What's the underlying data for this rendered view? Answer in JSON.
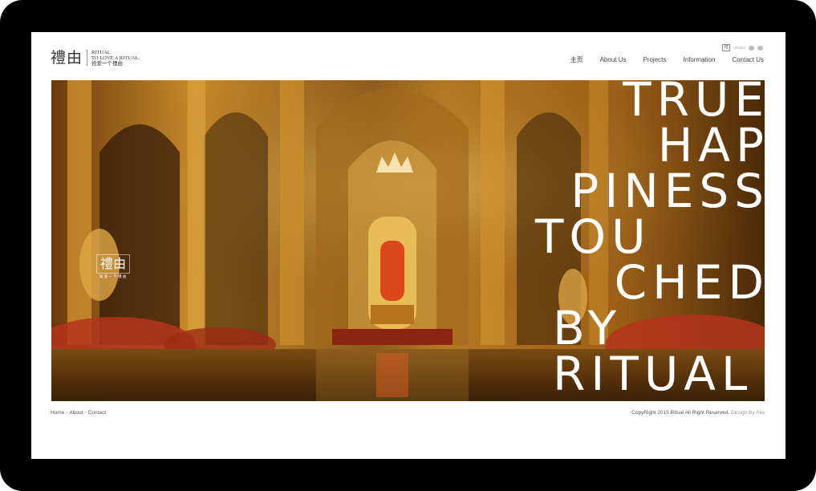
{
  "logo": {
    "mark": "禮由",
    "line1": "RITUAL",
    "line2": "TO LOVE A RITUAL.",
    "line3": "拾爱一个禮由"
  },
  "social": {
    "box": "禮",
    "text": "WEIBO"
  },
  "nav": {
    "items": [
      "主页",
      "About Us",
      "Projects",
      "Information",
      "Contact Us"
    ]
  },
  "hero": {
    "slogan": [
      "TRUE",
      "HAP",
      "PINESS",
      "TOU",
      "CHED",
      "BY",
      "RITUAL"
    ],
    "inner_logo": "禮由",
    "inner_logo_sub": "拾 爱 一 个 禮 由"
  },
  "footer": {
    "links": [
      "Home",
      "About",
      "Contact"
    ],
    "copyright": "CopyRight 2015 Ritual All Right Reserved.",
    "design": "Design By Aiia"
  },
  "colors": {
    "frame": "#000000",
    "gold": "#c8861e",
    "dark_brown": "#3a1e06",
    "throne_red": "#d9471a"
  }
}
